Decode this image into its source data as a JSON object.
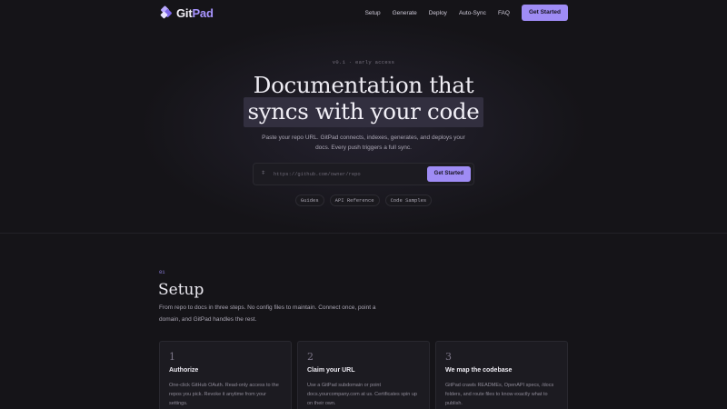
{
  "nav": {
    "logo_text_main": "Git",
    "logo_text_accent": "Pad",
    "links": [
      "Setup",
      "Generate",
      "Deploy",
      "Auto-Sync",
      "FAQ"
    ],
    "cta_label": "Get Started"
  },
  "hero": {
    "kicker": "v0.1 · early access",
    "title_line1": "Documentation that",
    "title_line2": "syncs with your code",
    "subtitle": "Paste your repo URL. GitPad connects, indexes, generates, and deploys your docs. Every push triggers a full sync.",
    "input_placeholder": "https://github.com/owner/repo",
    "input_value": "",
    "input_cta": "Get Started",
    "chips": [
      "Guides",
      "API Reference",
      "Code Samples"
    ]
  },
  "section": {
    "number": "01",
    "title": "Setup",
    "description": "From repo to docs in three steps. No config files to maintain. Connect once, point a domain, and GitPad handles the rest.",
    "cards": [
      {
        "number": "1",
        "title": "Authorize",
        "description": "One-click GitHub OAuth. Read-only access to the repos you pick. Revoke it anytime from your settings."
      },
      {
        "number": "2",
        "title": "Claim your URL",
        "description": "Use a GitPad subdomain or point docs.yourcompany.com at us. Certificates spin up on their own."
      },
      {
        "number": "3",
        "title": "We map the codebase",
        "description": "GitPad crawls READMEs, OpenAPI specs, /docs folders, and route files to know exactly what to publish."
      }
    ]
  },
  "colors": {
    "accent": "#9f8cf5",
    "background": "#151418",
    "card": "#1c1b21"
  }
}
